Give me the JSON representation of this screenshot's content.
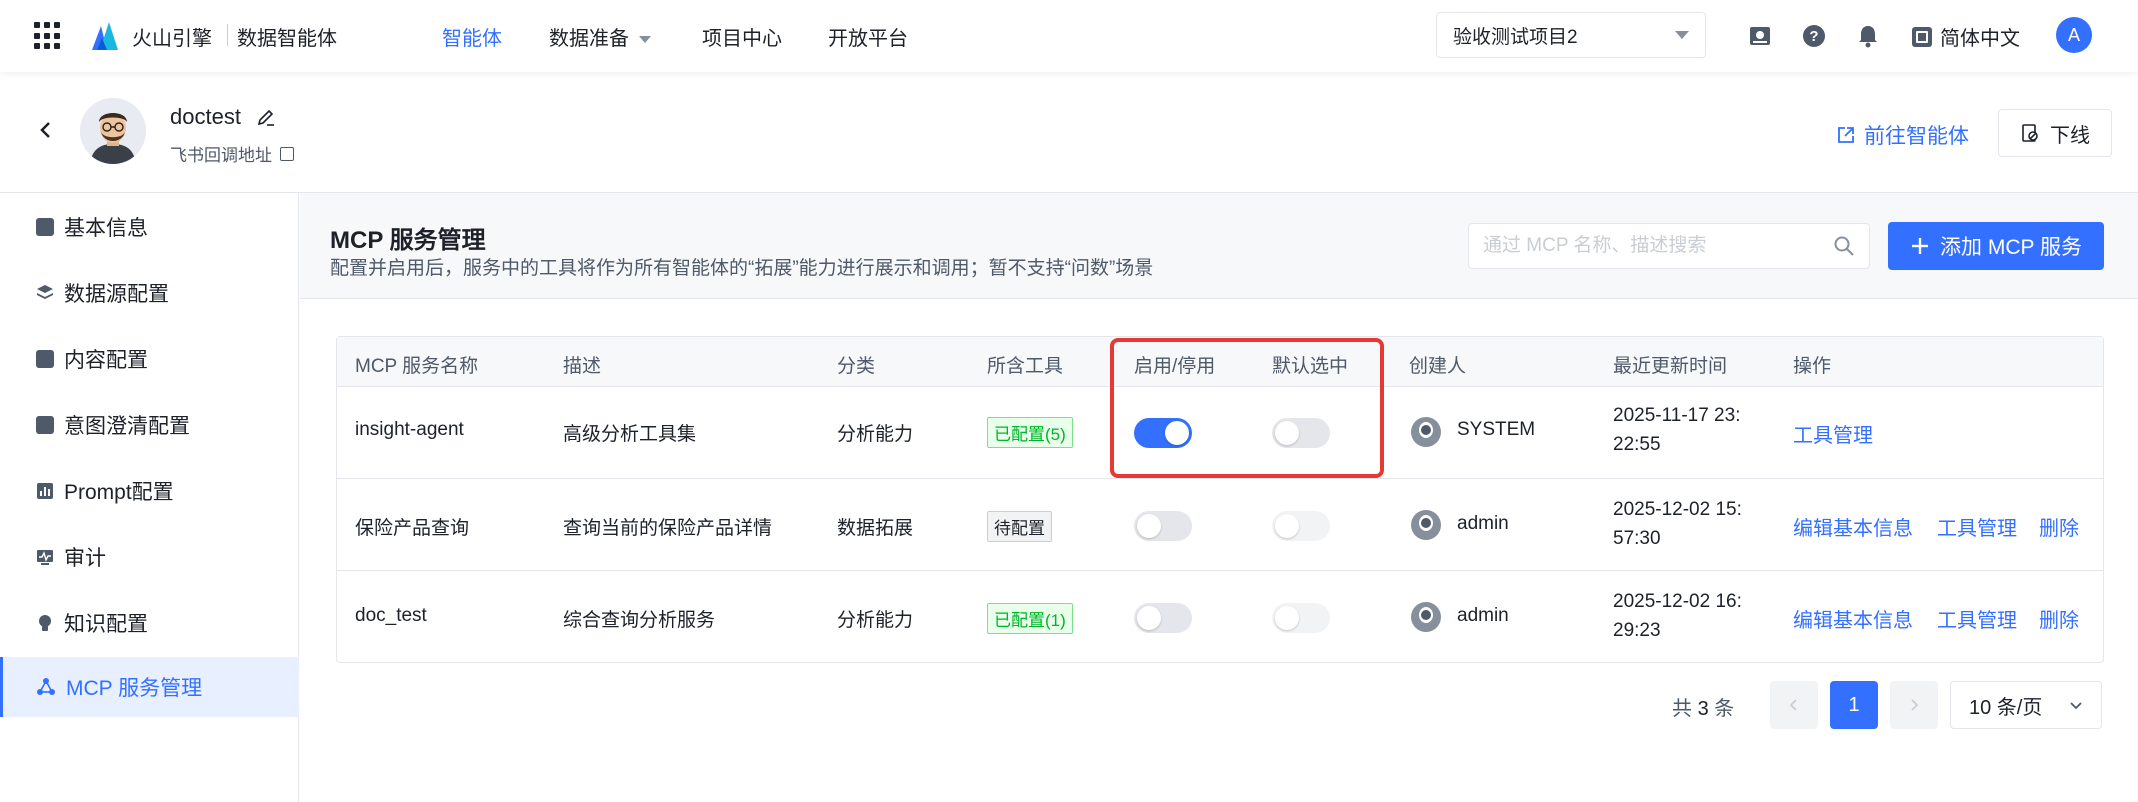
{
  "topbar": {
    "brand": "火山引擎",
    "product": "数据智能体",
    "nav": [
      {
        "label": "智能体",
        "active": true
      },
      {
        "label": "数据准备",
        "dropdown": true
      },
      {
        "label": "项目中心"
      },
      {
        "label": "开放平台"
      }
    ],
    "project": "验收测试项目2",
    "language": "简体中文",
    "user_initial": "A"
  },
  "agent": {
    "name": "doctest",
    "sub_label": "飞书回调地址",
    "goto_label": "前往智能体",
    "offline_label": "下线"
  },
  "sidebar": {
    "items": [
      {
        "label": "基本信息",
        "icon": "file-icon"
      },
      {
        "label": "数据源配置",
        "icon": "layers-icon"
      },
      {
        "label": "内容配置",
        "icon": "content-icon"
      },
      {
        "label": "意图澄清配置",
        "icon": "terminal-icon"
      },
      {
        "label": "Prompt配置",
        "icon": "chart-icon"
      },
      {
        "label": "审计",
        "icon": "monitor-icon"
      },
      {
        "label": "知识配置",
        "icon": "bulb-icon"
      },
      {
        "label": "MCP 服务管理",
        "icon": "mcp-icon",
        "active": true
      }
    ]
  },
  "main": {
    "title": "MCP 服务管理",
    "description": "配置并启用后，服务中的工具将作为所有智能体的“拓展”能力进行展示和调用；暂不支持“问数”场景",
    "search_placeholder": "通过 MCP 名称、描述搜索",
    "add_label": "添加 MCP 服务"
  },
  "table": {
    "headers": [
      "MCP 服务名称",
      "描述",
      "分类",
      "所含工具",
      "启用/停用",
      "默认选中",
      "创建人",
      "最近更新时间",
      "操作"
    ],
    "rows": [
      {
        "name": "insight-agent",
        "desc": "高级分析工具集",
        "category": "分析能力",
        "tools": "已配置(5)",
        "tools_status": "configured",
        "enabled": true,
        "default_selected": false,
        "creator": "SYSTEM",
        "updated_1": "2025-11-17 23:",
        "updated_2": "22:55",
        "actions": [
          "工具管理"
        ]
      },
      {
        "name": "保险产品查询",
        "desc": "查询当前的保险产品详情",
        "category": "数据拓展",
        "tools": "待配置",
        "tools_status": "pending",
        "enabled": false,
        "default_selected": false,
        "creator": "admin",
        "updated_1": "2025-12-02 15:",
        "updated_2": "57:30",
        "actions": [
          "编辑基本信息",
          "工具管理",
          "删除"
        ]
      },
      {
        "name": "doc_test",
        "desc": "综合查询分析服务",
        "category": "分析能力",
        "tools": "已配置(1)",
        "tools_status": "configured",
        "enabled": false,
        "default_selected": false,
        "creator": "admin",
        "updated_1": "2025-12-02 16:",
        "updated_2": "29:23",
        "actions": [
          "编辑基本信息",
          "工具管理",
          "删除"
        ]
      }
    ]
  },
  "pagination": {
    "total_prefix": "共",
    "total": "3",
    "total_suffix": "条",
    "current_page": "1",
    "page_size": "10 条/页"
  },
  "colors": {
    "accent": "#3370ff",
    "highlight": "#e53935",
    "success": "#00b42a"
  }
}
